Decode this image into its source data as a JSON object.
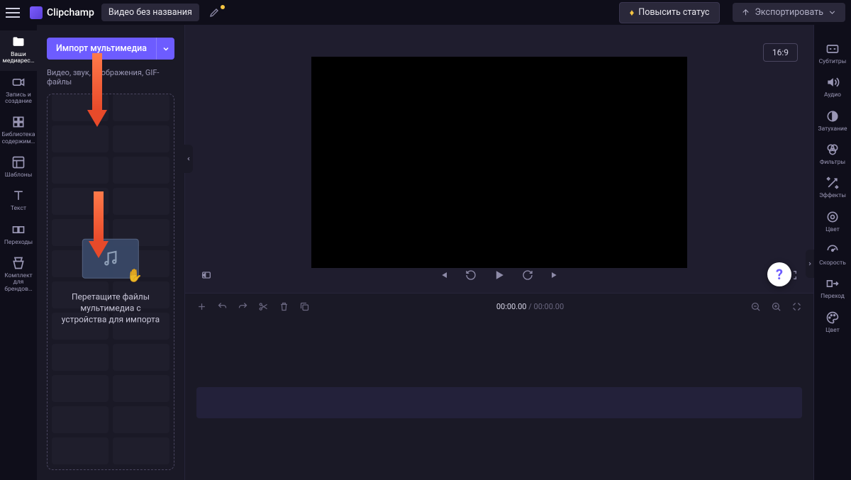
{
  "app": {
    "name": "Clipchamp"
  },
  "topbar": {
    "title": "Видео без названия",
    "upgrade": "Повысить статус",
    "export": "Экспортировать"
  },
  "leftRail": [
    {
      "id": "media",
      "label": "Ваши медиарес…"
    },
    {
      "id": "record",
      "label": "Запись и создание"
    },
    {
      "id": "library",
      "label": "Библиотека содержим…"
    },
    {
      "id": "templates",
      "label": "Шаблоны"
    },
    {
      "id": "text",
      "label": "Текст"
    },
    {
      "id": "transitions",
      "label": "Переходы"
    },
    {
      "id": "brandkit",
      "label": "Комплект для брендов…"
    }
  ],
  "mediaPanel": {
    "importLabel": "Импорт мультимедиа",
    "hint": "Видео, звук, изображения, GIF-файлы",
    "dropText": "Перетащите файлы мультимедиа с устройства для импорта"
  },
  "preview": {
    "aspect": "16:9"
  },
  "timeline": {
    "current": "00:00.00",
    "duration": "00:00.00"
  },
  "rightRail": [
    {
      "id": "captions",
      "label": "Субтитры"
    },
    {
      "id": "audio",
      "label": "Аудио"
    },
    {
      "id": "fade",
      "label": "Затухание"
    },
    {
      "id": "filters",
      "label": "Фильтры"
    },
    {
      "id": "effects",
      "label": "Эффекты"
    },
    {
      "id": "color",
      "label": "Цвет"
    },
    {
      "id": "speed",
      "label": "Скорость"
    },
    {
      "id": "transition",
      "label": "Переход"
    },
    {
      "id": "color2",
      "label": "Цвет"
    }
  ],
  "help": {
    "symbol": "?"
  }
}
